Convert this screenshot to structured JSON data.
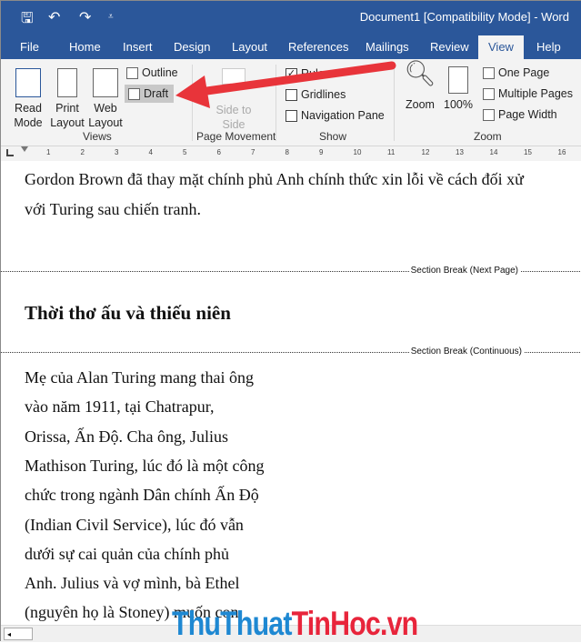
{
  "window": {
    "title": "Document1 [Compatibility Mode]  -  Word"
  },
  "qat": {
    "save": "🖫",
    "undo": "↶",
    "redo": "↷",
    "customize": "⩡"
  },
  "tabs": [
    "File",
    "Home",
    "Insert",
    "Design",
    "Layout",
    "References",
    "Mailings",
    "Review",
    "View",
    "Help"
  ],
  "active_tab": "View",
  "ribbon": {
    "views": {
      "label": "Views",
      "read_mode": "Read Mode",
      "print_layout": "Print Layout",
      "web_layout": "Web Layout",
      "outline": "Outline",
      "draft": "Draft"
    },
    "page_movement": {
      "label": "Page Movement",
      "side_to_side": "Side to Side"
    },
    "show": {
      "label": "Show",
      "ruler": "Ruler",
      "ruler_checked": true,
      "gridlines": "Gridlines",
      "gridlines_checked": false,
      "navigation_pane": "Navigation Pane",
      "navigation_pane_checked": false
    },
    "zoom": {
      "label": "Zoom",
      "zoom": "Zoom",
      "hundred": "100%",
      "one_page": "One Page",
      "multiple_pages": "Multiple Pages",
      "page_width": "Page Width"
    }
  },
  "ruler": {
    "numbers": [
      "1",
      "2",
      "3",
      "4",
      "5",
      "6",
      "7",
      "8",
      "9",
      "10",
      "11",
      "12",
      "13",
      "14",
      "15",
      "16"
    ]
  },
  "document": {
    "intro_lines": [
      "Gordon Brown đã thay mặt chính phủ Anh chính thức xin lỗi về cách đối xử",
      "với Turing sau chiến tranh."
    ],
    "break1": "Section Break (Next Page)",
    "heading": "Thời thơ ấu và thiếu niên",
    "break2": "Section Break (Continuous)",
    "body_lines": [
      "Mẹ của Alan Turing mang thai ông",
      "vào năm 1911, tại Chatrapur,",
      "Orissa, Ấn Độ. Cha ông, Julius",
      "Mathison Turing, lúc đó là một công",
      "chức trong ngành Dân chính Ấn Độ",
      "(Indian Civil Service), lúc đó vẫn",
      "dưới sự cai quản của chính phủ",
      "Anh. Julius và vợ mình, bà Ethel",
      "(nguyên họ là Stoney) muốn con"
    ]
  },
  "watermark": {
    "part1": "ThuThuat",
    "part2": "TinHoc",
    "part3": ".vn",
    "color1": "#1e88d2",
    "color2": "#e8253b"
  },
  "annotation": {
    "arrow_color": "#e8343a"
  }
}
